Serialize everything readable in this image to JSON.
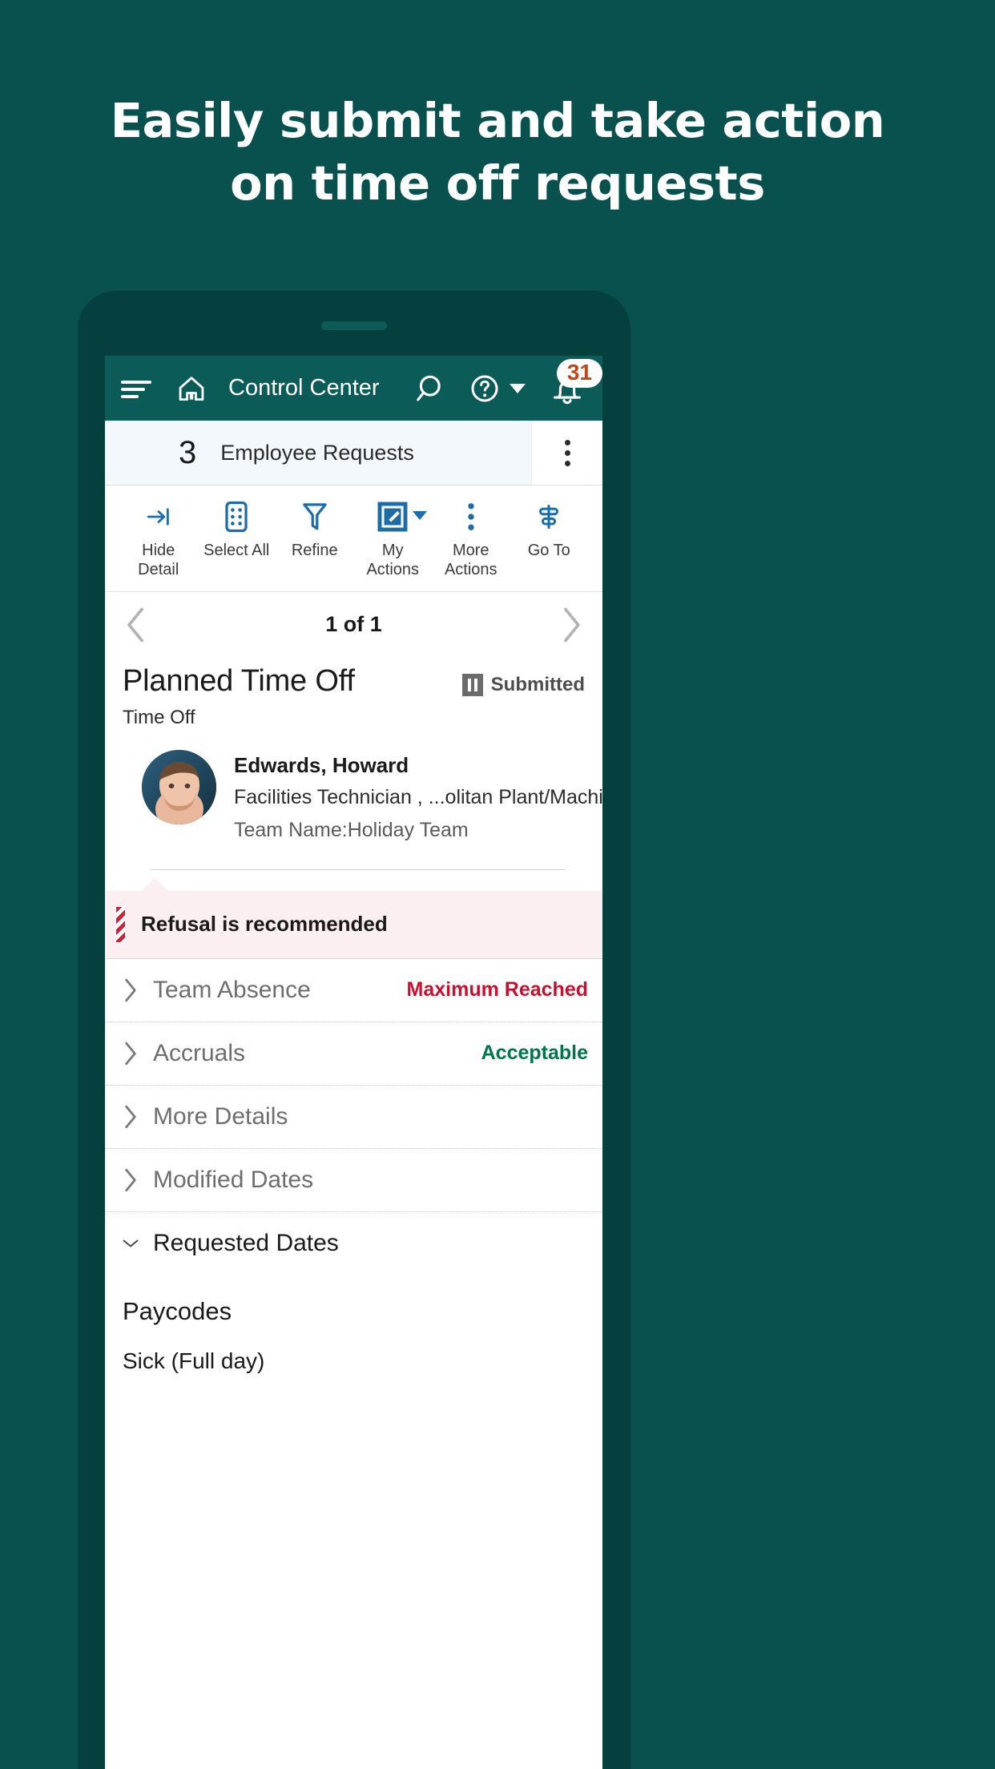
{
  "promo": {
    "headline_line1": "Easily submit and take action",
    "headline_line2": "on time off requests",
    "background_color": "#08514e"
  },
  "appbar": {
    "menu_icon": "hamburger-icon",
    "home_icon": "home-icon",
    "title": "Control Center",
    "search_icon": "search-icon",
    "help_icon": "help-circle-icon",
    "help_caret_icon": "chevron-down-icon",
    "bell_icon": "notification-bell-icon",
    "badge_count": "31",
    "badge_color": "#c0461a",
    "bar_color": "#0b5c58"
  },
  "summary": {
    "count": "3",
    "label": "Employee Requests",
    "kebab_icon": "more-vertical-icon"
  },
  "toolbar": {
    "accent_color": "#1b6ca8",
    "items": [
      {
        "icon": "hide-detail-icon",
        "label_line1": "Hide",
        "label_line2": "Detail",
        "dropdown": false
      },
      {
        "icon": "select-all-icon",
        "label_line1": "Select All",
        "label_line2": "",
        "dropdown": false
      },
      {
        "icon": "filter-funnel-icon",
        "label_line1": "Refine",
        "label_line2": "",
        "dropdown": false
      },
      {
        "icon": "my-actions-icon",
        "label_line1": "My",
        "label_line2": "Actions",
        "dropdown": true
      },
      {
        "icon": "more-vertical-icon",
        "label_line1": "More",
        "label_line2": "Actions",
        "dropdown": false
      },
      {
        "icon": "go-to-icon",
        "label_line1": "Go To",
        "label_line2": "",
        "dropdown": false
      }
    ]
  },
  "pager": {
    "prev_icon": "chevron-left-icon",
    "next_icon": "chevron-right-icon",
    "text": "1 of 1"
  },
  "request": {
    "title": "Planned Time Off",
    "status_icon": "pause-icon",
    "status_label": "Submitted",
    "subtitle": "Time Off",
    "employee": {
      "avatar": "employee-photo",
      "name": "Edwards, Howard",
      "role": "Facilities Technician ,  ...olitan Plant/Machine Shop",
      "team": "Team Name:Holiday Team"
    },
    "alert": {
      "icon": "warning-stripe-icon",
      "text": "Refusal is recommended",
      "background": "#fbeff1",
      "stripe_color": "#d21f35"
    },
    "sections": [
      {
        "label": "Team Absence",
        "value": "Maximum Reached",
        "value_state": "red",
        "expanded": false,
        "chevron": "chevron-right-icon"
      },
      {
        "label": "Accruals",
        "value": "Acceptable",
        "value_state": "green",
        "expanded": false,
        "chevron": "chevron-right-icon"
      },
      {
        "label": "More Details",
        "value": "",
        "value_state": "",
        "expanded": false,
        "chevron": "chevron-right-icon"
      },
      {
        "label": "Modified Dates",
        "value": "",
        "value_state": "",
        "expanded": false,
        "chevron": "chevron-right-icon"
      },
      {
        "label": "Requested Dates",
        "value": "",
        "value_state": "",
        "expanded": true,
        "chevron": "chevron-down-icon"
      }
    ],
    "paycodes": {
      "title": "Paycodes",
      "items": [
        "Sick (Full day)"
      ]
    }
  }
}
